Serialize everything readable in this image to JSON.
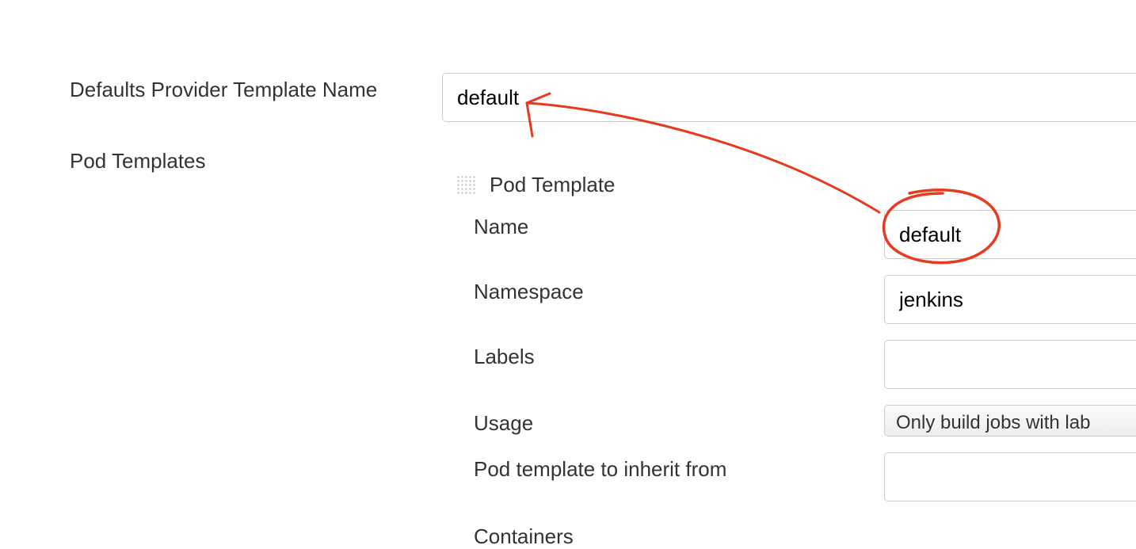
{
  "top": {
    "label": "Defaults Provider Template Name",
    "value": "default"
  },
  "section": {
    "label": "Pod Templates"
  },
  "pod_template": {
    "header": "Pod Template",
    "fields": {
      "name": {
        "label": "Name",
        "value": "default"
      },
      "namespace": {
        "label": "Namespace",
        "value": "jenkins"
      },
      "labels": {
        "label": "Labels",
        "value": ""
      },
      "usage": {
        "label": "Usage",
        "value": "Only build jobs with lab"
      },
      "inherit": {
        "label": "Pod template to inherit from",
        "value": ""
      },
      "containers": {
        "label": "Containers"
      }
    }
  }
}
